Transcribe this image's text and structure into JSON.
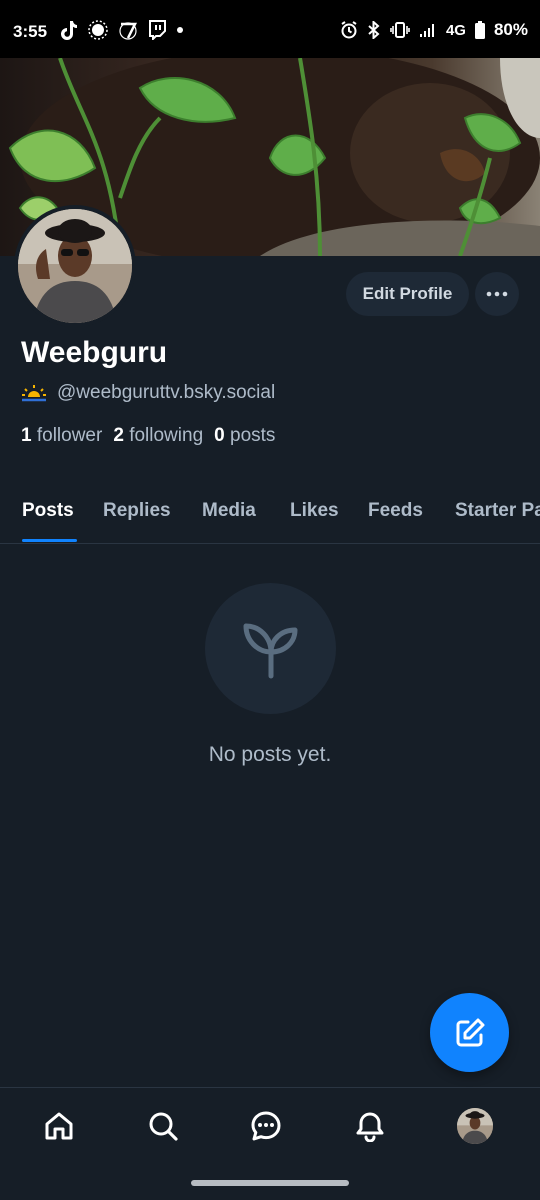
{
  "status_bar": {
    "time": "3:55",
    "network": "4G",
    "battery": "80%",
    "icons": [
      "tiktok-icon",
      "brightness-icon",
      "app-icon",
      "twitch-icon",
      "dot-icon",
      "alarm-icon",
      "bluetooth-icon",
      "vibrate-icon",
      "signal-icon",
      "battery-icon"
    ]
  },
  "profile": {
    "display_name": "Weebguru",
    "handle": "@weebguruttv.bsky.social",
    "edit_button": "Edit Profile",
    "followers_count": "1",
    "followers_label": "follower",
    "following_count": "2",
    "following_label": "following",
    "posts_count": "0",
    "posts_label": "posts"
  },
  "tabs": [
    {
      "label": "Posts",
      "active": true
    },
    {
      "label": "Replies",
      "active": false
    },
    {
      "label": "Media",
      "active": false
    },
    {
      "label": "Likes",
      "active": false
    },
    {
      "label": "Feeds",
      "active": false
    },
    {
      "label": "Starter Packs",
      "active": false
    }
  ],
  "empty_state": {
    "message": "No posts yet.",
    "icon": "sprout-icon"
  },
  "bottom_nav": {
    "items": [
      "home-icon",
      "search-icon",
      "chat-icon",
      "bell-icon",
      "profile-avatar"
    ]
  },
  "colors": {
    "background": "#161e27",
    "surface": "#1e2936",
    "accent": "#1083fe",
    "muted_text": "#aebbc9"
  }
}
